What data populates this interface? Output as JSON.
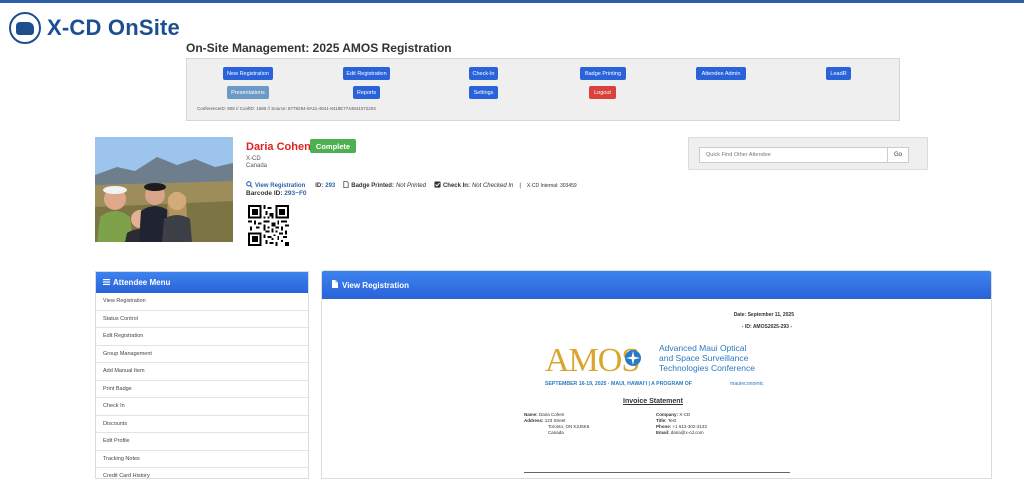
{
  "app": {
    "title": "X-CD OnSite"
  },
  "page_title": "On-Site Management: 2025 AMOS Registration",
  "toolbar": {
    "new_registration": "New Registration",
    "edit_registration": "Edit Registration",
    "check_in": "Check-In",
    "badge_printing": "Badge Printing",
    "attendee_admin": "Attendee Admin",
    "leadr": "LeadR",
    "presentations": "Presentations",
    "reports": "Reports",
    "settings": "Settings",
    "logout": "Logout",
    "conference_info": "ConferenceID: 808 // ConfID: 1690 // Source: 8779294-8A11-4641-8418E7744841072203"
  },
  "attendee": {
    "name": "Daria Cohen",
    "status": "Complete",
    "company": "X-CD",
    "country": "Canada",
    "view_registration": "View Registration",
    "id_label": "ID:",
    "id_value": "293",
    "badge_printed_label": "Badge Printed:",
    "badge_printed_value": "Not Printed",
    "check_in_label": "Check In:",
    "check_in_value": "Not Checked In",
    "separator": "|",
    "internal": "X-CD Internal: 303459",
    "barcode_label": "Barcode ID:",
    "barcode_value": "293~F0"
  },
  "quick_find": {
    "placeholder": "Quick Find Other Attendee",
    "go_label": "Go"
  },
  "attendee_menu": {
    "title": "Attendee Menu",
    "items": [
      "View Registration",
      "Status Control",
      "Edit Registration",
      "Group Management",
      "Add Manual Item",
      "Print Badge",
      "Check In",
      "Discounts",
      "Edit Profile",
      "Tracking Notes",
      "Credit Card History"
    ]
  },
  "panel": {
    "title": "View Registration",
    "date": "Date: September 11, 2025",
    "doc_id": "- ID: AMOS2025-293 -",
    "logo": {
      "wordmark": "AMOS",
      "line1": "Advanced Maui Optical",
      "line2": "and Space Surveillance",
      "line3": "Technologies Conference",
      "dates": "SEPTEMBER 16-19, 2025 · MAUI, HAWAIʻI | A PROGRAM OF",
      "org": "mauieconomic"
    },
    "invoice_title": "Invoice Statement",
    "left": {
      "name_label": "Name:",
      "name_value": "Daria Cohen",
      "address_label": "Address:",
      "address1": "123 Street",
      "address2": "Toronto, ON  K2J5K5",
      "address3": "Canada"
    },
    "right": {
      "company_label": "Company:",
      "company_value": "X-CD",
      "title_label": "Title:",
      "title_value": "Test",
      "phone_label": "Phone:",
      "phone_value": "+1 613-302-3133",
      "email_label": "Email:",
      "email_value": "daria@x-cd.com"
    }
  },
  "colors": {
    "primary_button": "#2a62d9",
    "secondary_button": "#6c9ac6",
    "danger_button": "#d9413c",
    "complete_badge": "#4caf50",
    "name": "#dd2222",
    "amos_gold": "#d9a52a",
    "amos_blue": "#2a7ac2"
  }
}
